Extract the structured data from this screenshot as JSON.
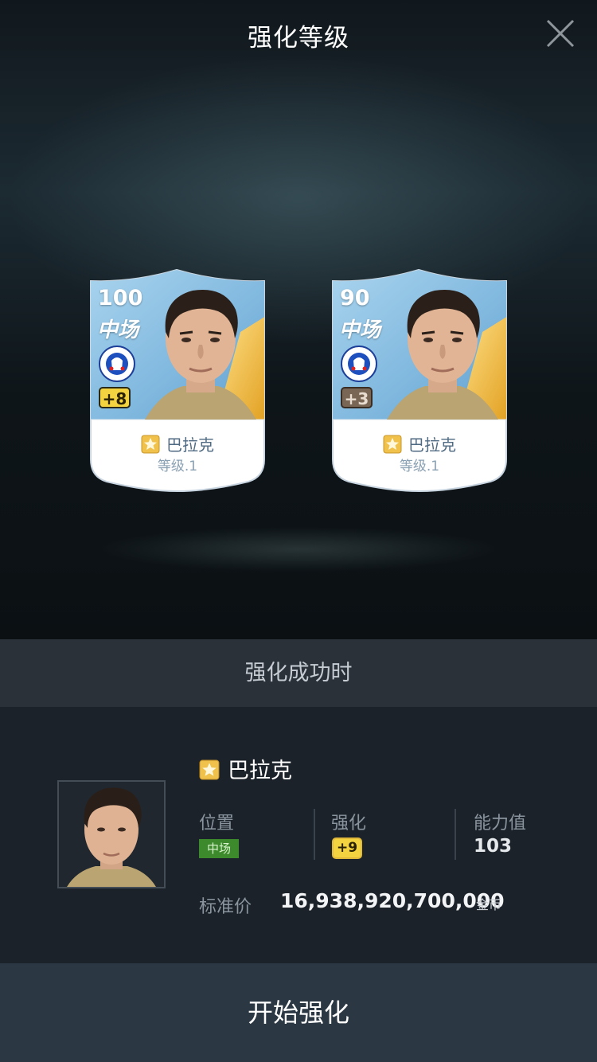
{
  "header": {
    "title": "强化等级"
  },
  "cards": [
    {
      "rating": "100",
      "position": "中场",
      "boost": "+8",
      "boost_style": "gold",
      "name": "巴拉克",
      "level": "等级.1"
    },
    {
      "rating": "90",
      "position": "中场",
      "boost": "+3",
      "boost_style": "bronze",
      "name": "巴拉克",
      "level": "等级.1"
    }
  ],
  "section": {
    "title": "强化成功时"
  },
  "result": {
    "name": "巴拉克",
    "stats": {
      "position_label": "位置",
      "position_value": "中场",
      "boost_label": "强化",
      "boost_value": "+9",
      "power_label": "能力值",
      "power_value": "103"
    },
    "price_label": "标准价",
    "price_value": "16,938,920,700,000",
    "price_unit": "金币"
  },
  "actions": {
    "start_label": "开始强化"
  },
  "colors": {
    "card_sky": "#8ec3e4",
    "boost_gold": "#f3d33f",
    "boost_bronze": "#7a6654",
    "position_tag": "#3d8a2d"
  }
}
